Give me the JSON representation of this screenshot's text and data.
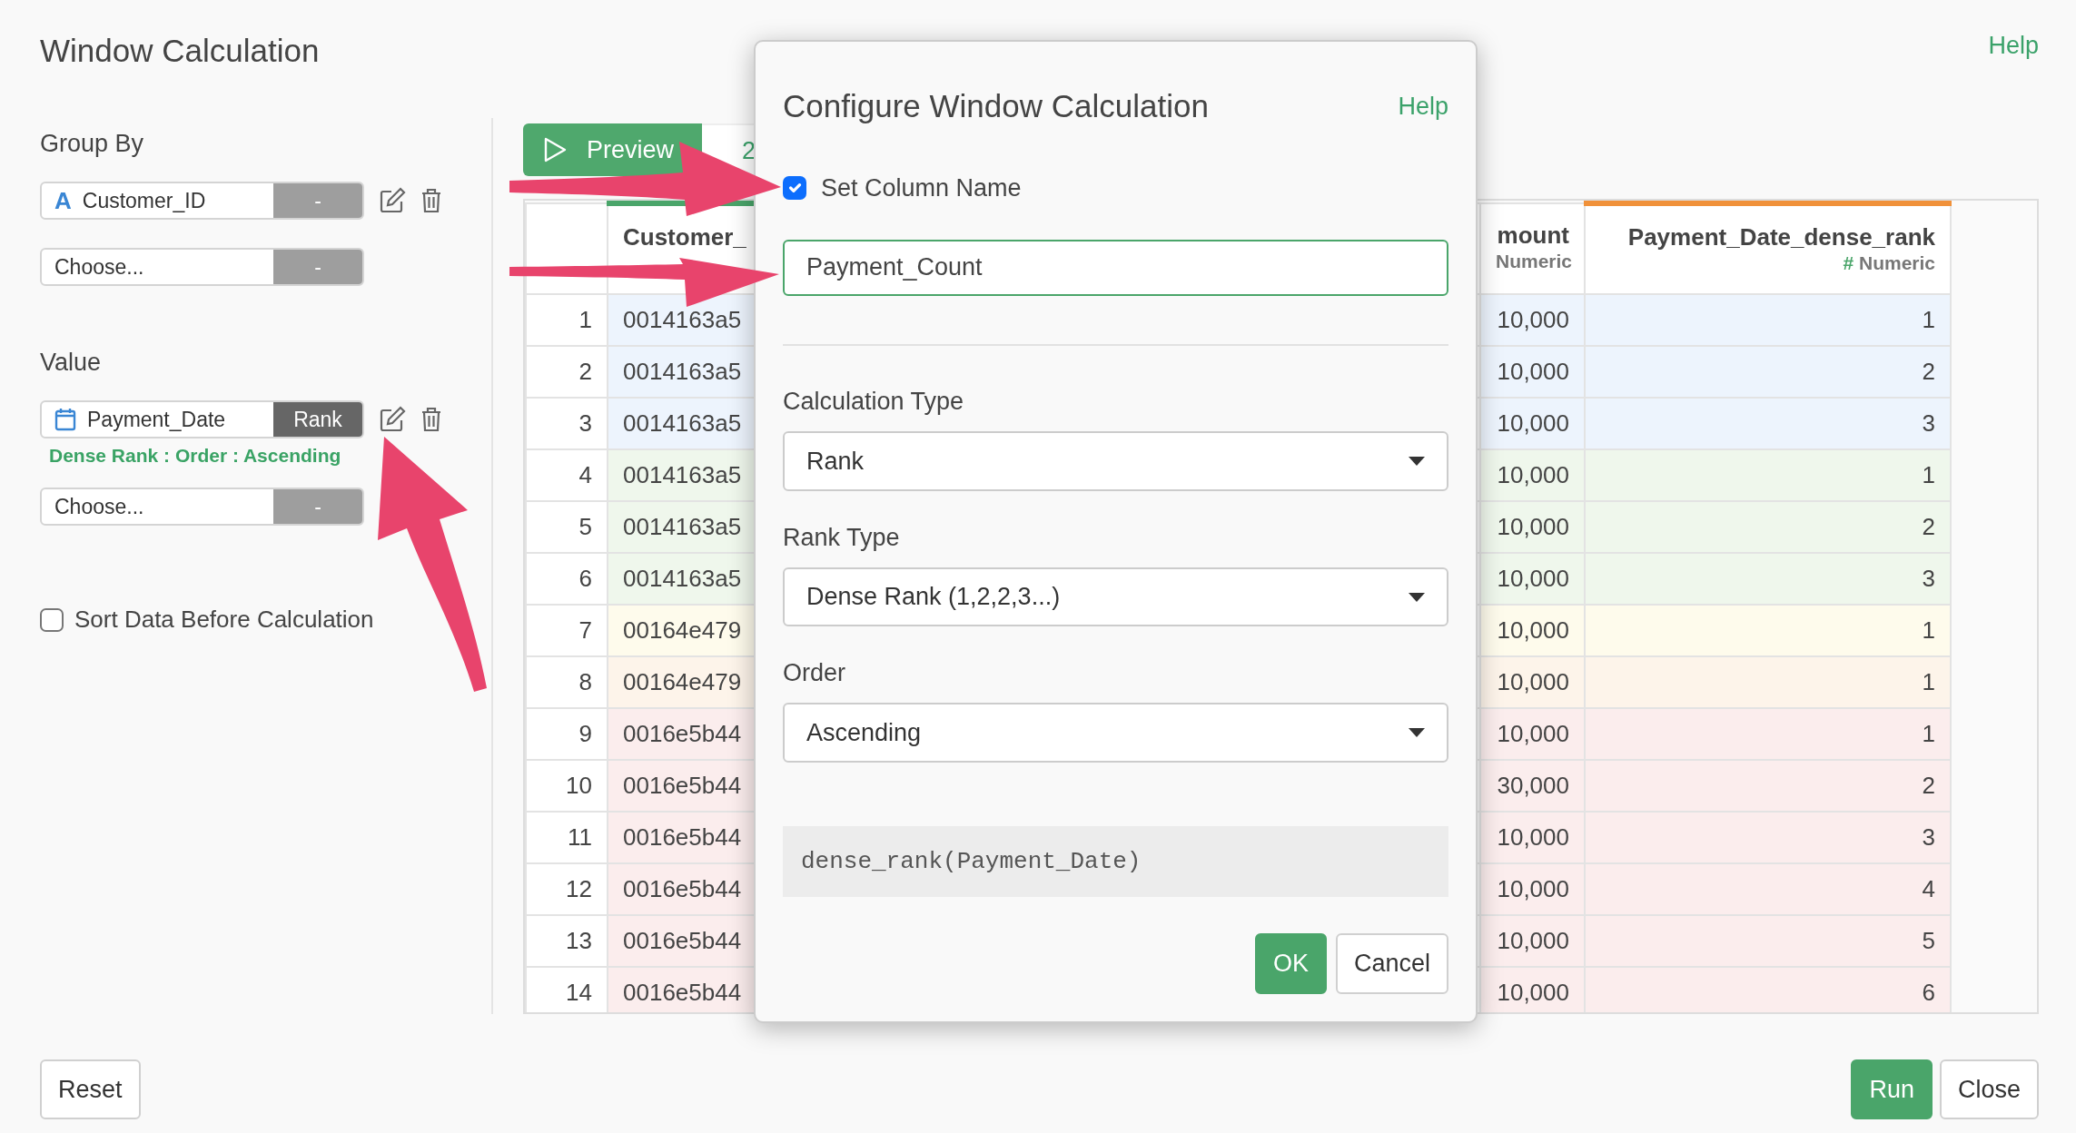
{
  "page": {
    "title": "Window Calculation",
    "help": "Help"
  },
  "group_by": {
    "label": "Group By",
    "items": [
      {
        "kind": "text_column",
        "type_icon": "A",
        "name": "Customer_ID",
        "tag": "-",
        "set": false
      },
      {
        "kind": "empty",
        "name": "Choose...",
        "tag": "-",
        "set": false
      }
    ]
  },
  "value": {
    "label": "Value",
    "items": [
      {
        "kind": "date_column",
        "name": "Payment_Date",
        "tag": "Rank",
        "set": true,
        "summary": "Dense Rank : Order : Ascending"
      },
      {
        "kind": "empty",
        "name": "Choose...",
        "tag": "-",
        "set": false
      }
    ]
  },
  "sort_option": {
    "label": "Sort Data Before Calculation",
    "checked": false
  },
  "preview_bar": {
    "button": "Preview",
    "next_tab": "2"
  },
  "table": {
    "columns": [
      {
        "name": "Customer_",
        "kind": "group"
      },
      {
        "name": "mount",
        "type_label": "Numeric",
        "kind": "plain"
      },
      {
        "name": "Payment_Date_dense_rank",
        "type_icon": "#",
        "type_label": "Numeric",
        "kind": "new"
      }
    ],
    "rows": [
      {
        "number": "1",
        "color": "#edf4fd",
        "cells": [
          "0014163a5",
          "10,000",
          "1"
        ]
      },
      {
        "number": "2",
        "color": "#edf4fd",
        "cells": [
          "0014163a5",
          "10,000",
          "2"
        ]
      },
      {
        "number": "3",
        "color": "#edf4fd",
        "cells": [
          "0014163a5",
          "10,000",
          "3"
        ]
      },
      {
        "number": "4",
        "color": "#eff7ec",
        "cells": [
          "0014163a5",
          "10,000",
          "1"
        ]
      },
      {
        "number": "5",
        "color": "#eff7ec",
        "cells": [
          "0014163a5",
          "10,000",
          "2"
        ]
      },
      {
        "number": "6",
        "color": "#eff7ec",
        "cells": [
          "0014163a5",
          "10,000",
          "3"
        ]
      },
      {
        "number": "7",
        "color": "#fefbec",
        "cells": [
          "00164e479",
          "10,000",
          "1"
        ]
      },
      {
        "number": "8",
        "color": "#fdf4ea",
        "cells": [
          "00164e479",
          "10,000",
          "1"
        ]
      },
      {
        "number": "9",
        "color": "#fbeded",
        "cells": [
          "0016e5b44",
          "10,000",
          "1"
        ]
      },
      {
        "number": "10",
        "color": "#fbeded",
        "cells": [
          "0016e5b44",
          "30,000",
          "2"
        ]
      },
      {
        "number": "11",
        "color": "#fbeded",
        "cells": [
          "0016e5b44",
          "10,000",
          "3"
        ]
      },
      {
        "number": "12",
        "color": "#fbeded",
        "cells": [
          "0016e5b44",
          "10,000",
          "4"
        ]
      },
      {
        "number": "13",
        "color": "#fbeded",
        "cells": [
          "0016e5b44",
          "10,000",
          "5"
        ]
      },
      {
        "number": "14",
        "color": "#fbeded",
        "cells": [
          "0016e5b44",
          "10,000",
          "6"
        ]
      }
    ]
  },
  "footer": {
    "reset": "Reset",
    "run": "Run",
    "close": "Close"
  },
  "modal": {
    "title": "Configure Window Calculation",
    "help": "Help",
    "set_name": {
      "label": "Set Column Name",
      "checked": true
    },
    "name_input": {
      "value": "Payment_Count",
      "focused": true
    },
    "fields": [
      {
        "label": "Calculation Type",
        "value": "Rank"
      },
      {
        "label": "Rank Type",
        "value": "Dense Rank (1,2,2,3...)"
      },
      {
        "label": "Order",
        "value": "Ascending"
      }
    ],
    "expression": "dense_rank(Payment_Date)",
    "ok": "OK",
    "cancel": "Cancel"
  }
}
